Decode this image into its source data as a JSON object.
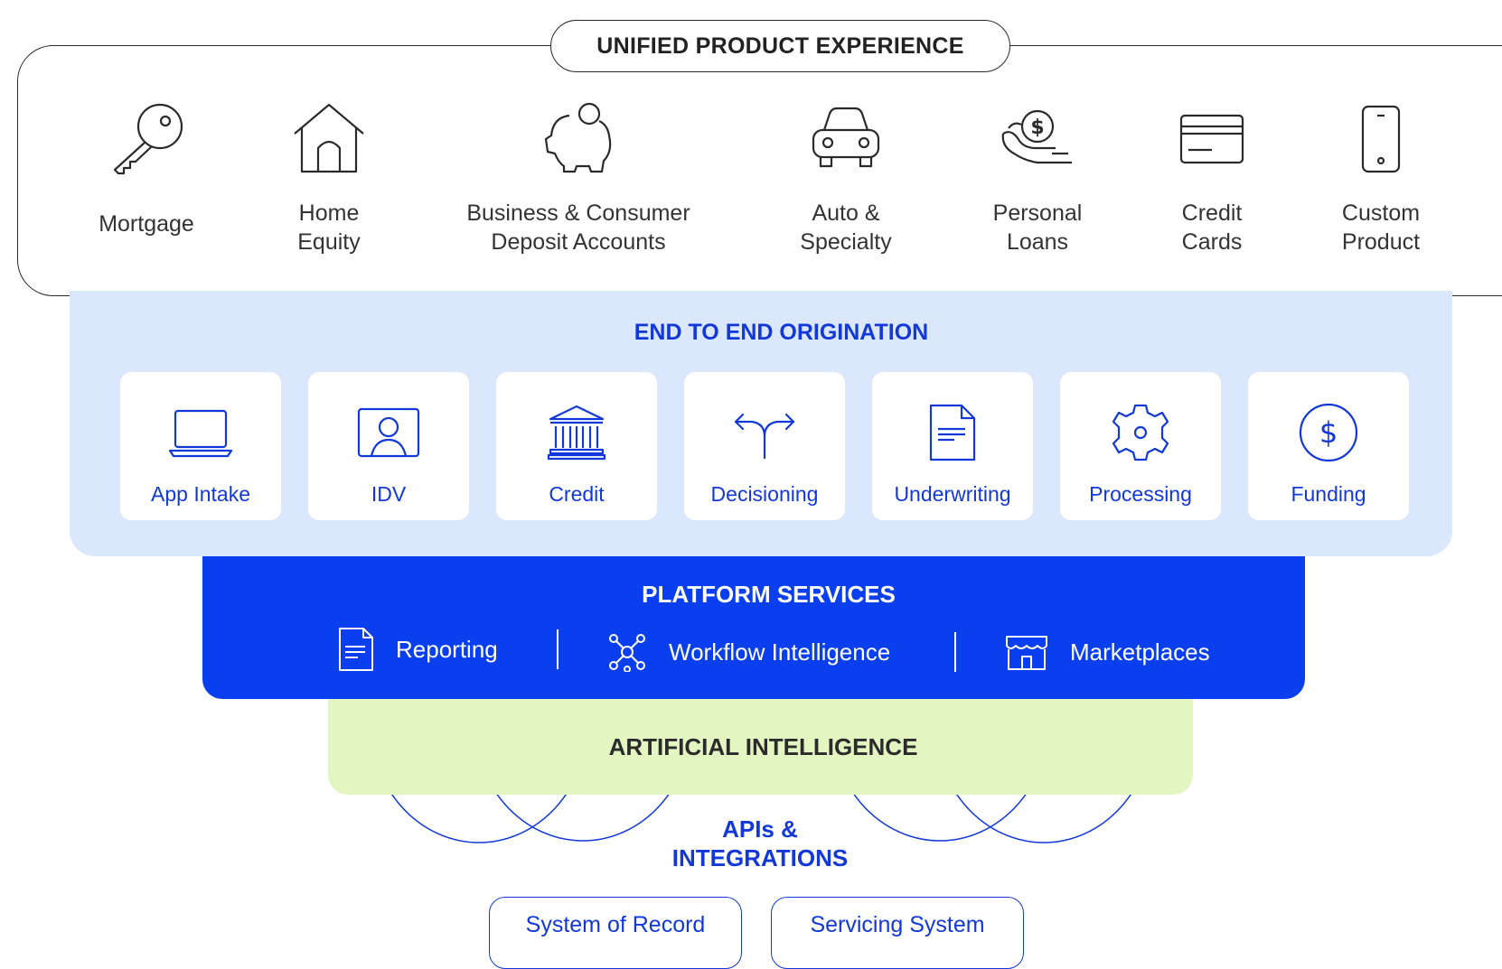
{
  "unified": {
    "title": "UNIFIED PRODUCT EXPERIENCE",
    "products": [
      {
        "line1": "Mortgage",
        "line2": "",
        "icon": "key-icon"
      },
      {
        "line1": "Home",
        "line2": "Equity",
        "icon": "house-icon"
      },
      {
        "line1": "Business & Consumer",
        "line2": "Deposit Accounts",
        "icon": "piggy-bank-icon"
      },
      {
        "line1": "Auto &",
        "line2": "Specialty",
        "icon": "car-icon"
      },
      {
        "line1": "Personal",
        "line2": "Loans",
        "icon": "hand-coin-icon"
      },
      {
        "line1": "Credit",
        "line2": "Cards",
        "icon": "credit-card-icon"
      },
      {
        "line1": "Custom",
        "line2": "Product",
        "icon": "smartphone-icon"
      }
    ]
  },
  "origination": {
    "title": "END TO END ORIGINATION",
    "steps": [
      {
        "label": "App Intake",
        "icon": "laptop-icon"
      },
      {
        "label": "IDV",
        "icon": "id-card-icon"
      },
      {
        "label": "Credit",
        "icon": "bank-icon"
      },
      {
        "label": "Decisioning",
        "icon": "split-arrow-icon"
      },
      {
        "label": "Underwriting",
        "icon": "document-icon"
      },
      {
        "label": "Processing",
        "icon": "gear-icon"
      },
      {
        "label": "Funding",
        "icon": "dollar-circle-icon"
      }
    ]
  },
  "platform": {
    "title": "PLATFORM SERVICES",
    "services": [
      {
        "label": "Reporting",
        "icon": "report-icon"
      },
      {
        "label": "Workflow Intelligence",
        "icon": "network-icon"
      },
      {
        "label": "Marketplaces",
        "icon": "storefront-icon"
      }
    ]
  },
  "ai": {
    "title": "ARTIFICIAL INTELLIGENCE"
  },
  "apis": {
    "title_line1": "APIs &",
    "title_line2": "INTEGRATIONS",
    "systems": [
      "System of Record",
      "Servicing System"
    ]
  },
  "colors": {
    "origination_bg": "#dbe7fd",
    "platform_bg": "#0a3ff0",
    "ai_bg": "#e3f6c2",
    "accent_blue": "#1238d9",
    "dark": "#2a2a2a"
  }
}
